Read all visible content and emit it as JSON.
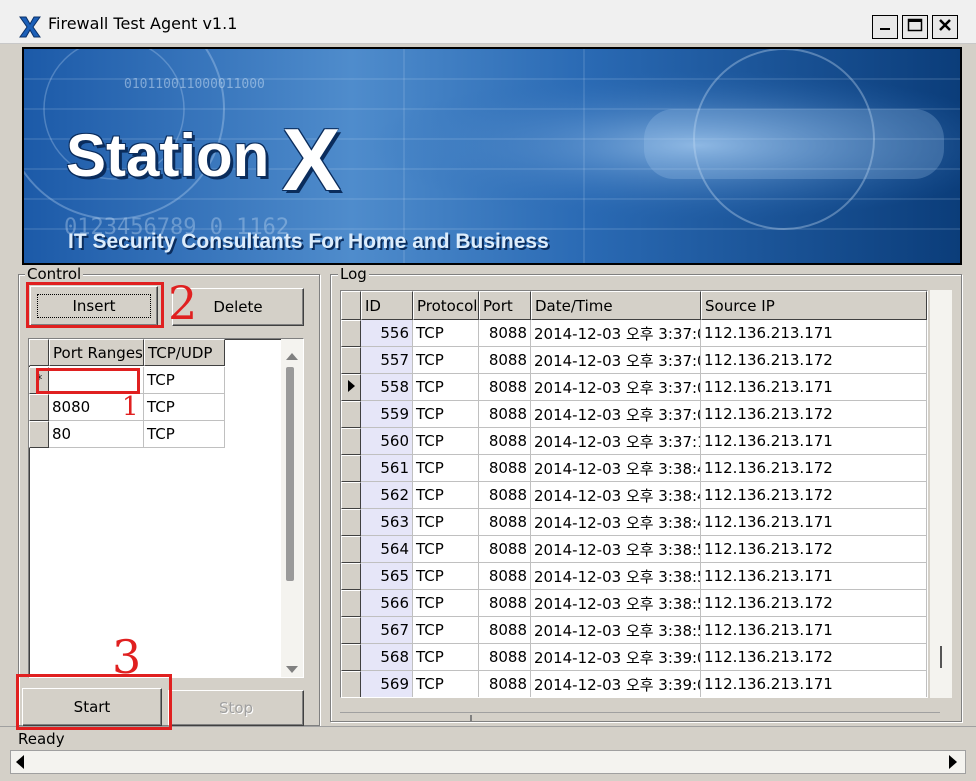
{
  "window": {
    "title": "Firewall Test Agent v1.1",
    "controls": {
      "minimize": "_",
      "maximize": "□",
      "close": "✕"
    }
  },
  "banner": {
    "logo_text": "Station",
    "logo_x": "X",
    "tagline": "IT Security Consultants For Home and Business",
    "bg_digits_1": "010110011000011000",
    "bg_digits_2": "0123456789 0 1162"
  },
  "control": {
    "legend": "Control",
    "insert_label": "Insert",
    "delete_label": "Delete",
    "start_label": "Start",
    "stop_label": "Stop",
    "ports_grid": {
      "headers": [
        "Port Ranges",
        "TCP/UDP"
      ],
      "rows": [
        {
          "port": "",
          "proto": "TCP",
          "indicator": "*"
        },
        {
          "port": "8080",
          "proto": "TCP",
          "indicator": ""
        },
        {
          "port": "80",
          "proto": "TCP",
          "indicator": ""
        }
      ]
    }
  },
  "log": {
    "legend": "Log",
    "headers": [
      "ID",
      "Protocol",
      "Port",
      "Date/Time",
      "Source IP"
    ],
    "rows": [
      {
        "id": "556",
        "protocol": "TCP",
        "port": "8088",
        "datetime": "2014-12-03 오후 3:37:0",
        "source_ip": "112.136.213.171"
      },
      {
        "id": "557",
        "protocol": "TCP",
        "port": "8088",
        "datetime": "2014-12-03 오후 3:37:0",
        "source_ip": "112.136.213.172"
      },
      {
        "id": "558",
        "protocol": "TCP",
        "port": "8088",
        "datetime": "2014-12-03 오후 3:37:0",
        "source_ip": "112.136.213.171",
        "current": true
      },
      {
        "id": "559",
        "protocol": "TCP",
        "port": "8088",
        "datetime": "2014-12-03 오후 3:37:0",
        "source_ip": "112.136.213.172"
      },
      {
        "id": "560",
        "protocol": "TCP",
        "port": "8088",
        "datetime": "2014-12-03 오후 3:37:1",
        "source_ip": "112.136.213.171"
      },
      {
        "id": "561",
        "protocol": "TCP",
        "port": "8088",
        "datetime": "2014-12-03 오후 3:38:4",
        "source_ip": "112.136.213.172"
      },
      {
        "id": "562",
        "protocol": "TCP",
        "port": "8088",
        "datetime": "2014-12-03 오후 3:38:4",
        "source_ip": "112.136.213.172"
      },
      {
        "id": "563",
        "protocol": "TCP",
        "port": "8088",
        "datetime": "2014-12-03 오후 3:38:4",
        "source_ip": "112.136.213.171"
      },
      {
        "id": "564",
        "protocol": "TCP",
        "port": "8088",
        "datetime": "2014-12-03 오후 3:38:5",
        "source_ip": "112.136.213.172"
      },
      {
        "id": "565",
        "protocol": "TCP",
        "port": "8088",
        "datetime": "2014-12-03 오후 3:38:5",
        "source_ip": "112.136.213.171"
      },
      {
        "id": "566",
        "protocol": "TCP",
        "port": "8088",
        "datetime": "2014-12-03 오후 3:38:5",
        "source_ip": "112.136.213.172"
      },
      {
        "id": "567",
        "protocol": "TCP",
        "port": "8088",
        "datetime": "2014-12-03 오후 3:38:5",
        "source_ip": "112.136.213.171"
      },
      {
        "id": "568",
        "protocol": "TCP",
        "port": "8088",
        "datetime": "2014-12-03 오후 3:39:0",
        "source_ip": "112.136.213.172"
      },
      {
        "id": "569",
        "protocol": "TCP",
        "port": "8088",
        "datetime": "2014-12-03 오후 3:39:0",
        "source_ip": "112.136.213.171"
      }
    ]
  },
  "status": {
    "text": "Ready"
  },
  "annotations": {
    "step1": "1",
    "step2": "2",
    "step3": "3"
  },
  "colors": {
    "annotation_red": "#e02020",
    "id_cell_bg": "#e6e6f8",
    "banner_blue": "#0d3f7e"
  }
}
